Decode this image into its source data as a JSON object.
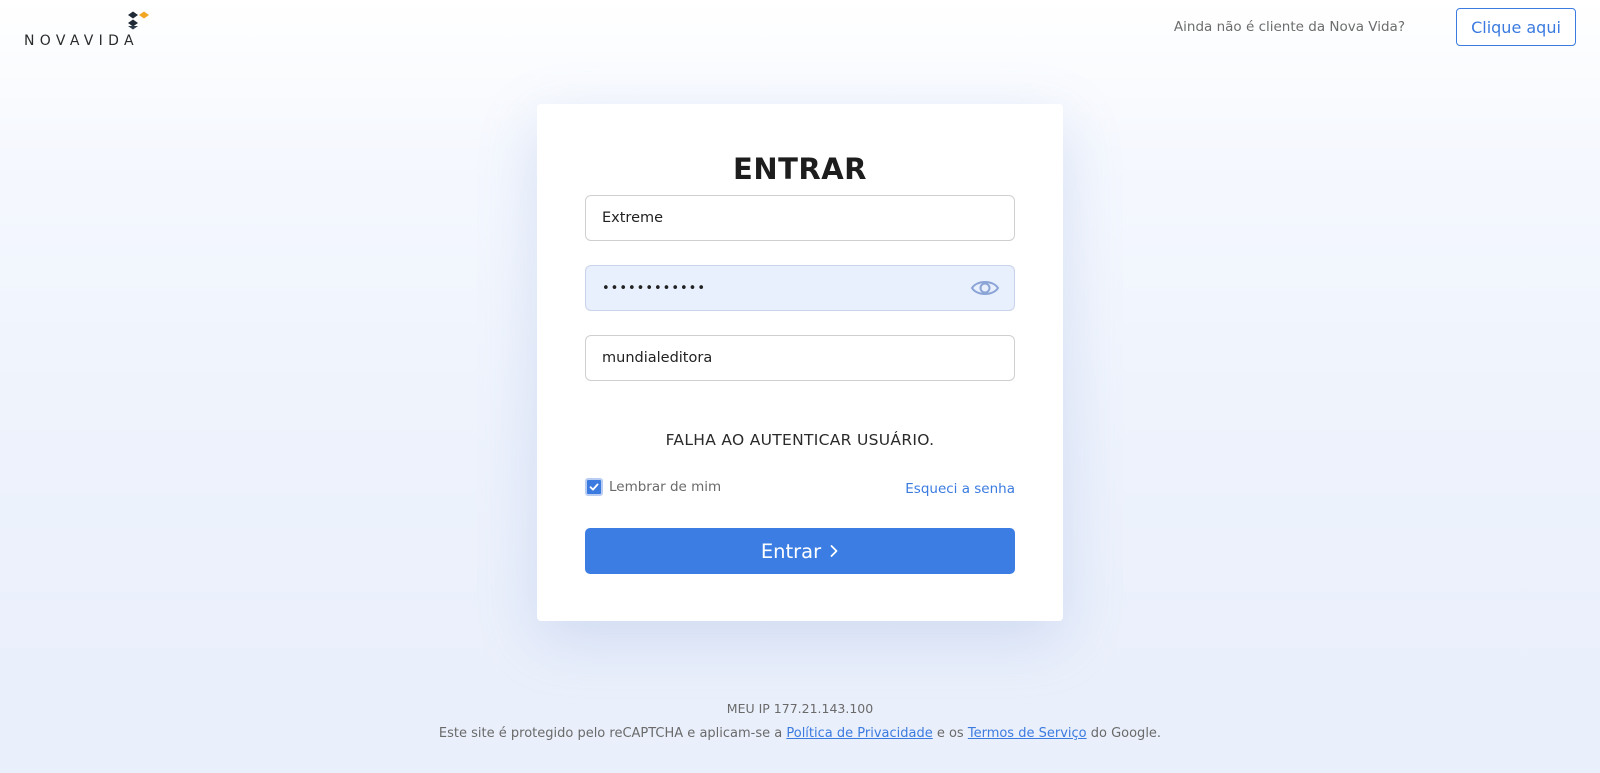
{
  "header": {
    "logo_text": "NOVAVIDA",
    "signup_prompt": "Ainda não é cliente da Nova Vida?",
    "signup_button": "Clique aqui"
  },
  "login": {
    "title": "ENTRAR",
    "username_value": "Extreme",
    "password_value": "••••••••••••",
    "company_value": "mundialeditora",
    "error_message": "FALHA AO AUTENTICAR USUÁRIO.",
    "remember_label": "Lembrar de mim",
    "remember_checked": true,
    "forgot_link": "Esqueci a senha",
    "submit_label": "Entrar"
  },
  "footer": {
    "ip_text": "MEU IP 177.21.143.100",
    "notice_prefix": "Este site é protegido pelo reCAPTCHA e aplicam-se a ",
    "privacy_link": "Política de Privacidade",
    "notice_middle": " e os ",
    "terms_link": "Termos de Serviço",
    "notice_suffix": " do Google."
  },
  "icons": {
    "logo_mark": "novavida-logo-icon",
    "eye": "eye-icon",
    "check": "check-icon",
    "chevron": "chevron-right-icon"
  },
  "colors": {
    "accent": "#3b7be0",
    "logo_orange": "#f2a623",
    "logo_dark": "#1f2a36",
    "password_bg": "#e8effd"
  }
}
